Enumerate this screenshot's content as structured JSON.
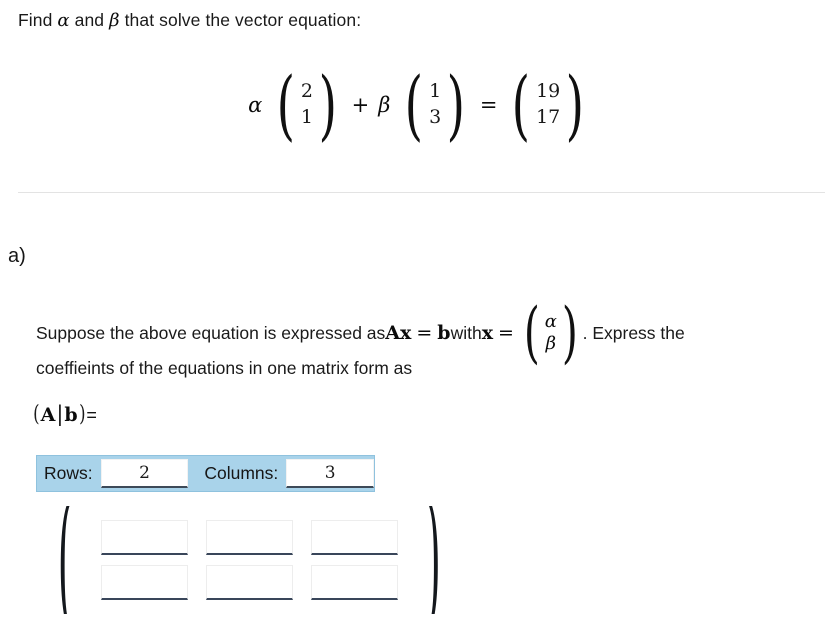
{
  "prompt": {
    "before_alpha": "Find ",
    "alpha": "α",
    "between": " and ",
    "beta": "β",
    "after_beta": " that solve the vector equation:"
  },
  "main_equation": {
    "alpha": "α",
    "vector_1": {
      "top": "2",
      "bottom": "1"
    },
    "plus": "+",
    "beta": "β",
    "vector_2": {
      "top": "1",
      "bottom": "3"
    },
    "equals": "=",
    "vector_result": {
      "top": "19",
      "bottom": "17"
    },
    "left_paren": "(",
    "right_paren": ")"
  },
  "part": {
    "label": "a)",
    "line1_part1": "Suppose the above equation is expressed as ",
    "line1_A": "A",
    "line1_x": "x",
    "line1_equals": "=",
    "line1_b": "b",
    "line1_with": " with ",
    "line1_x2": "x",
    "line1_equals2": "=",
    "x_vector": {
      "top": "α",
      "bottom": "β"
    },
    "line1_tail": ". Express the",
    "line2": "coeffieints  of the equations in one matrix form as",
    "augmented": {
      "open": "(",
      "A": "A",
      "bar": "|",
      "b": "b",
      "close": ")",
      "equals": "="
    }
  },
  "dimension_panel": {
    "rows_label": "Rows:",
    "rows_value": "2",
    "columns_label": "Columns:",
    "columns_value": "3",
    "background_color": "#a9d3ea"
  },
  "matrix_entry": {
    "left_paren": "(",
    "right_paren": ")",
    "rows": 2,
    "columns": 3,
    "cells": [
      [
        "",
        "",
        ""
      ],
      [
        "",
        "",
        ""
      ]
    ],
    "placeholder": ""
  }
}
